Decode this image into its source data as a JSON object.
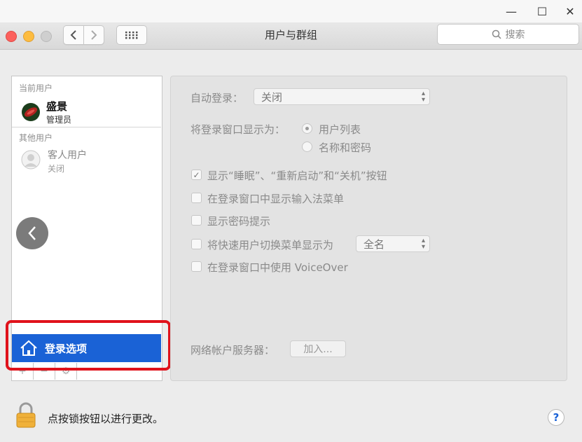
{
  "window": {
    "title": "用户与群组",
    "search_placeholder": "搜索",
    "controls": {
      "minimize": "—",
      "maximize": "☐",
      "close": "✕"
    },
    "nav_icons": [
      "chevron-left-icon",
      "chevron-right-icon",
      "grid-icon"
    ]
  },
  "sidebar": {
    "current_users_label": "当前用户",
    "current_user": {
      "name": "盛景",
      "role": "管理员"
    },
    "other_users_label": "其他用户",
    "guest_user": {
      "name": "客人用户",
      "status": "关闭"
    },
    "login_options_label": "登录选项",
    "bottom_tools": [
      "+",
      "−",
      "⚙"
    ],
    "accent_color": "#1a62d6",
    "highlight_color": "#e0121b"
  },
  "settings": {
    "auto_login": {
      "label": "自动登录：",
      "value": "关闭"
    },
    "login_window_display": {
      "label": "将登录窗口显示为：",
      "options": [
        "用户列表",
        "名称和密码"
      ],
      "selected": "用户列表"
    },
    "checkboxes": [
      {
        "label": "显示“睡眠”、“重新启动”和“关机”按钮",
        "checked": true
      },
      {
        "label": "在登录窗口中显示输入法菜单",
        "checked": false
      },
      {
        "label": "显示密码提示",
        "checked": false
      },
      {
        "label": "将快速用户切换菜单显示为",
        "checked": false
      },
      {
        "label": "在登录窗口中使用 VoiceOver",
        "checked": false
      }
    ],
    "fast_switch_value": "全名",
    "network_server": {
      "label": "网络帐户服务器：",
      "button": "加入..."
    }
  },
  "footer": {
    "lock_text": "点按锁按钮以进行更改。",
    "help_label": "?"
  }
}
